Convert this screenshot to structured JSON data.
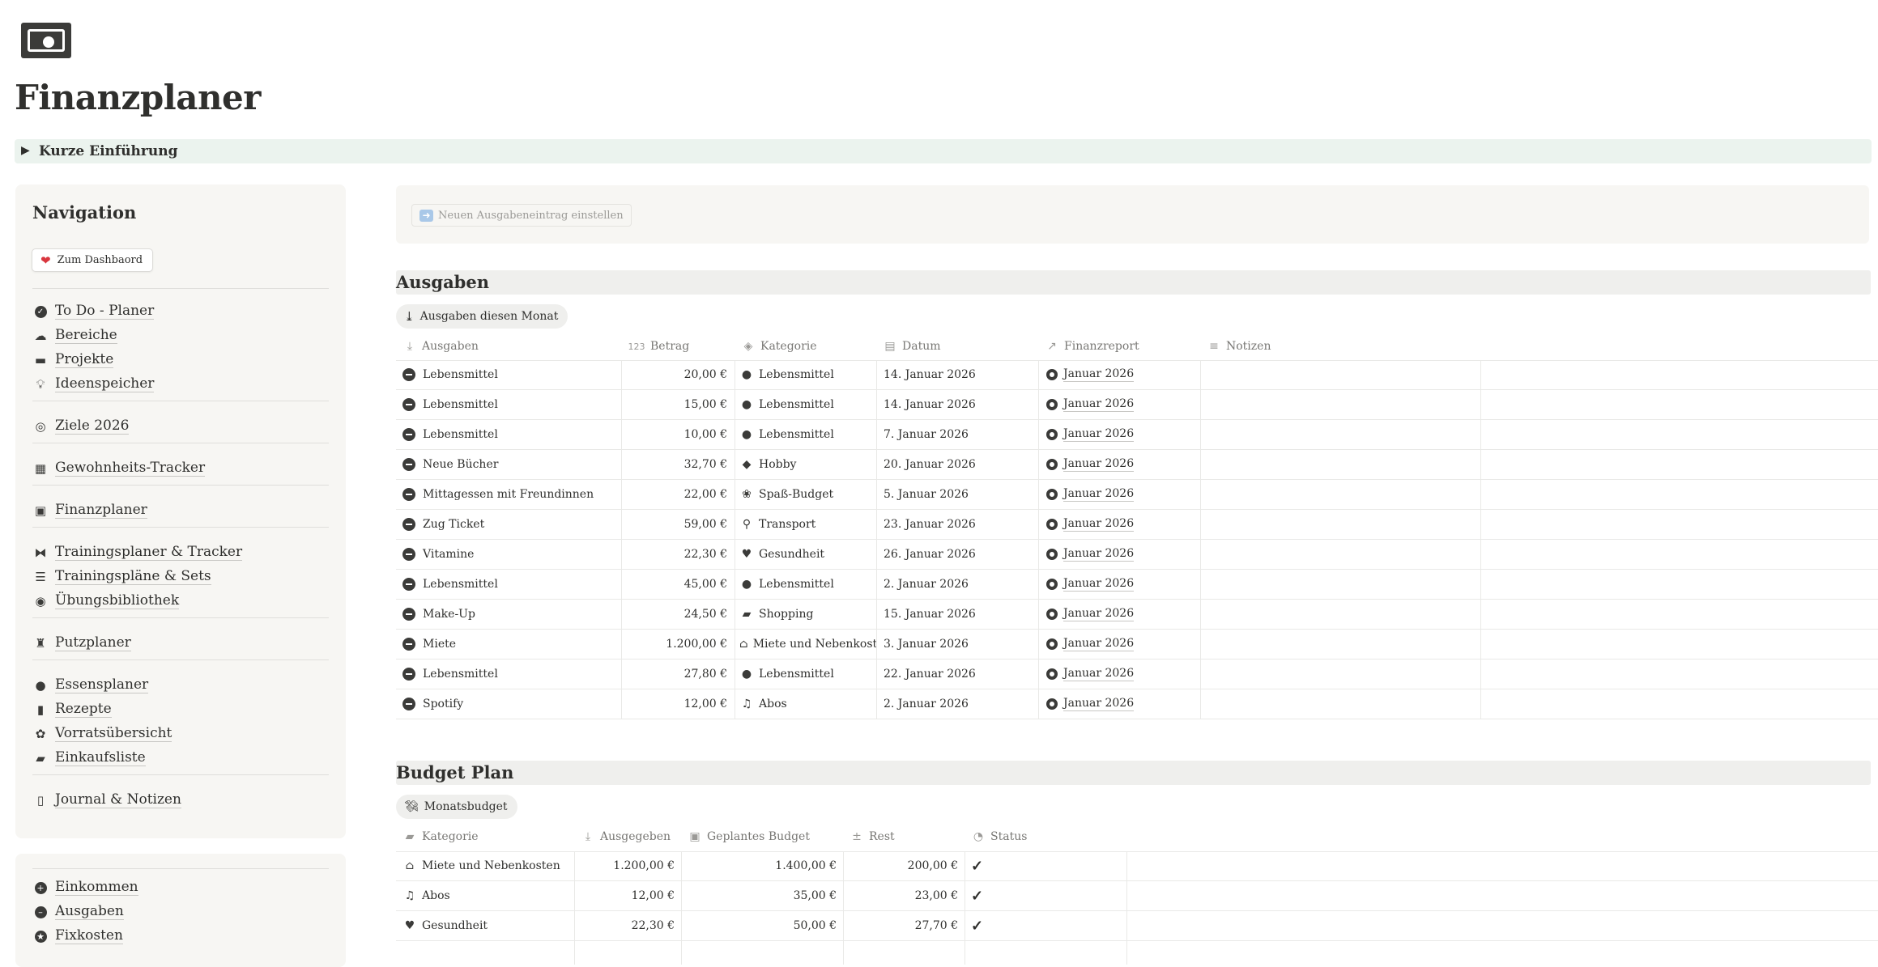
{
  "page": {
    "title": "Finanzplaner",
    "icon": "money-bill-icon",
    "toggle_label": "Kurze Einführung"
  },
  "sidebar": {
    "heading": "Navigation",
    "dashboard_button": "Zum Dashbaord",
    "groups": [
      [
        {
          "label": "To Do - Planer",
          "icon": "check-circle-icon"
        },
        {
          "label": "Bereiche",
          "icon": "cloud-icon"
        },
        {
          "label": "Projekte",
          "icon": "folder-icon"
        },
        {
          "label": "Ideenspeicher",
          "icon": "lightbulb-icon"
        }
      ],
      [
        {
          "label": "Ziele 2026",
          "icon": "target-icon"
        }
      ],
      [
        {
          "label": "Gewohnheits-Tracker",
          "icon": "calendar-icon"
        }
      ],
      [
        {
          "label": "Finanzplaner",
          "icon": "money-bill-icon"
        }
      ],
      [
        {
          "label": "Trainingsplaner & Tracker",
          "icon": "dumbbell-icon"
        },
        {
          "label": "Trainingspläne & Sets",
          "icon": "lines-icon"
        },
        {
          "label": "Übungsbibliothek",
          "icon": "ring-icon"
        }
      ],
      [
        {
          "label": "Putzplaner",
          "icon": "broom-icon"
        }
      ],
      [
        {
          "label": "Essensplaner",
          "icon": "apple-icon"
        },
        {
          "label": "Rezepte",
          "icon": "book-icon"
        },
        {
          "label": "Vorratsübersicht",
          "icon": "basket-icon"
        },
        {
          "label": "Einkaufsliste",
          "icon": "bag-icon"
        }
      ],
      [
        {
          "label": "Journal & Notizen",
          "icon": "open-book-icon"
        }
      ]
    ],
    "finance_items": [
      {
        "label": "Einkommen",
        "icon": "plus-circle-icon"
      },
      {
        "label": "Ausgaben",
        "icon": "minus-circle-icon"
      },
      {
        "label": "Fixkosten",
        "icon": "star-circle-icon"
      }
    ]
  },
  "main": {
    "new_entry_button": "Neuen Ausgabeneintrag einstellen",
    "expenses": {
      "heading": "Ausgaben",
      "view_tab": "Ausgaben diesen Monat",
      "columns": [
        "Ausgaben",
        "Betrag",
        "Kategorie",
        "Datum",
        "Finanzreport",
        "Notizen"
      ],
      "rows": [
        {
          "name": "Lebensmittel",
          "amount": "20,00 €",
          "category": "Lebensmittel",
          "cat_icon": "apple-icon",
          "date": "14. Januar 2026",
          "report": "Januar 2026",
          "notes": ""
        },
        {
          "name": "Lebensmittel",
          "amount": "15,00 €",
          "category": "Lebensmittel",
          "cat_icon": "apple-icon",
          "date": "14. Januar 2026",
          "report": "Januar 2026",
          "notes": ""
        },
        {
          "name": "Lebensmittel",
          "amount": "10,00 €",
          "category": "Lebensmittel",
          "cat_icon": "apple-icon",
          "date": "7. Januar 2026",
          "report": "Januar 2026",
          "notes": ""
        },
        {
          "name": "Neue Bücher",
          "amount": "32,70 €",
          "category": "Hobby",
          "cat_icon": "kite-icon",
          "date": "20. Januar 2026",
          "report": "Januar 2026",
          "notes": ""
        },
        {
          "name": "Mittagessen mit Freundinnen",
          "amount": "22,00 €",
          "category": "Spaß-Budget",
          "cat_icon": "balloon-icon",
          "date": "5. Januar 2026",
          "report": "Januar 2026",
          "notes": ""
        },
        {
          "name": "Zug Ticket",
          "amount": "59,00 €",
          "category": "Transport",
          "cat_icon": "bicycle-icon",
          "date": "23. Januar 2026",
          "report": "Januar 2026",
          "notes": ""
        },
        {
          "name": "Vitamine",
          "amount": "22,30 €",
          "category": "Gesundheit",
          "cat_icon": "heart-pulse-icon",
          "date": "26. Januar 2026",
          "report": "Januar 2026",
          "notes": ""
        },
        {
          "name": "Lebensmittel",
          "amount": "45,00 €",
          "category": "Lebensmittel",
          "cat_icon": "apple-icon",
          "date": "2. Januar 2026",
          "report": "Januar 2026",
          "notes": ""
        },
        {
          "name": "Make-Up",
          "amount": "24,50 €",
          "category": "Shopping",
          "cat_icon": "bag-icon",
          "date": "15. Januar 2026",
          "report": "Januar 2026",
          "notes": ""
        },
        {
          "name": "Miete",
          "amount": "1.200,00 €",
          "category": "Miete und Nebenkosten",
          "cat_icon": "house-icon",
          "date": "3. Januar 2026",
          "report": "Januar 2026",
          "notes": ""
        },
        {
          "name": "Lebensmittel",
          "amount": "27,80 €",
          "category": "Lebensmittel",
          "cat_icon": "apple-icon",
          "date": "22. Januar 2026",
          "report": "Januar 2026",
          "notes": ""
        },
        {
          "name": "Spotify",
          "amount": "12,00 €",
          "category": "Abos",
          "cat_icon": "music-icon",
          "date": "2. Januar 2026",
          "report": "Januar 2026",
          "notes": ""
        }
      ]
    },
    "budget": {
      "heading": "Budget Plan",
      "view_tab": "Monatsbudget",
      "columns": [
        "Kategorie",
        "Ausgegeben",
        "Geplantes Budget",
        "Rest",
        "Status"
      ],
      "rows": [
        {
          "category": "Miete und Nebenkosten",
          "cat_icon": "house-icon",
          "spent": "1.200,00 €",
          "planned": "1.400,00 €",
          "rest": "200,00 €",
          "status": "✓"
        },
        {
          "category": "Abos",
          "cat_icon": "music-icon",
          "spent": "12,00 €",
          "planned": "35,00 €",
          "rest": "23,00 €",
          "status": "✓"
        },
        {
          "category": "Gesundheit",
          "cat_icon": "heart-pulse-icon",
          "spent": "22,30 €",
          "planned": "50,00 €",
          "rest": "27,70 €",
          "status": "✓"
        }
      ]
    }
  }
}
